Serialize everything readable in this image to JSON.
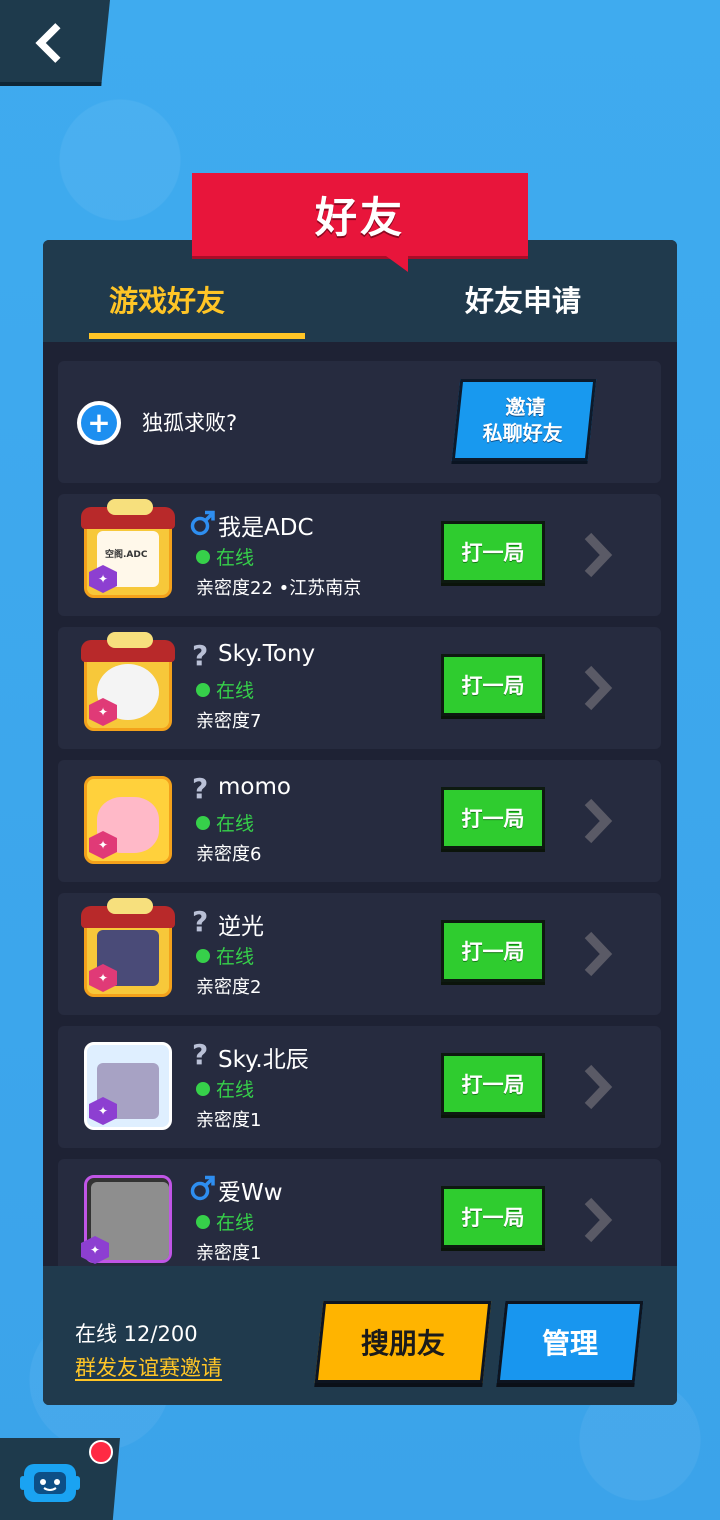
{
  "header": {
    "title": "好友"
  },
  "tabs": [
    {
      "label": "游戏好友",
      "active": true
    },
    {
      "label": "好友申请",
      "active": false
    }
  ],
  "invite": {
    "prompt": "独孤求败?",
    "button_line1": "邀请",
    "button_line2": "私聊好友"
  },
  "friends": [
    {
      "name": "我是ADC",
      "gender": "male",
      "status": "在线",
      "intimacy": "亲密度22 •江苏南京",
      "avatar_text": "空阁.ADC",
      "action": "打一局"
    },
    {
      "name": "Sky.Tony",
      "gender": "unknown",
      "status": "在线",
      "intimacy": "亲密度7",
      "action": "打一局"
    },
    {
      "name": "momo",
      "gender": "unknown",
      "status": "在线",
      "intimacy": "亲密度6",
      "action": "打一局"
    },
    {
      "name": "逆光",
      "gender": "unknown",
      "status": "在线",
      "intimacy": "亲密度2",
      "action": "打一局"
    },
    {
      "name": "Sky.北辰",
      "gender": "unknown",
      "status": "在线",
      "intimacy": "亲密度1",
      "action": "打一局"
    },
    {
      "name": "爱Ww",
      "gender": "male",
      "status": "在线",
      "intimacy": "亲密度1",
      "action": "打一局"
    }
  ],
  "footer": {
    "online_count": "在线 12/200",
    "group_invite": "群发友谊赛邀请",
    "search_label": "搜朋友",
    "manage_label": "管理"
  },
  "icons": {
    "back": "back-chevron-icon",
    "chat": "chat-robot-icon",
    "male": "male-symbol-icon",
    "unknown": "question-mark-icon",
    "arrow": "chevron-right-icon"
  },
  "colors": {
    "background": "#3aa6ec",
    "panel": "#1e2234",
    "header_bar": "#203a4d",
    "title_ribbon": "#e8153b",
    "active_tab": "#ffc526",
    "online": "#36d04a",
    "play_button": "#2fcc2f",
    "search_button": "#ffb400",
    "manage_button": "#1896ef"
  }
}
